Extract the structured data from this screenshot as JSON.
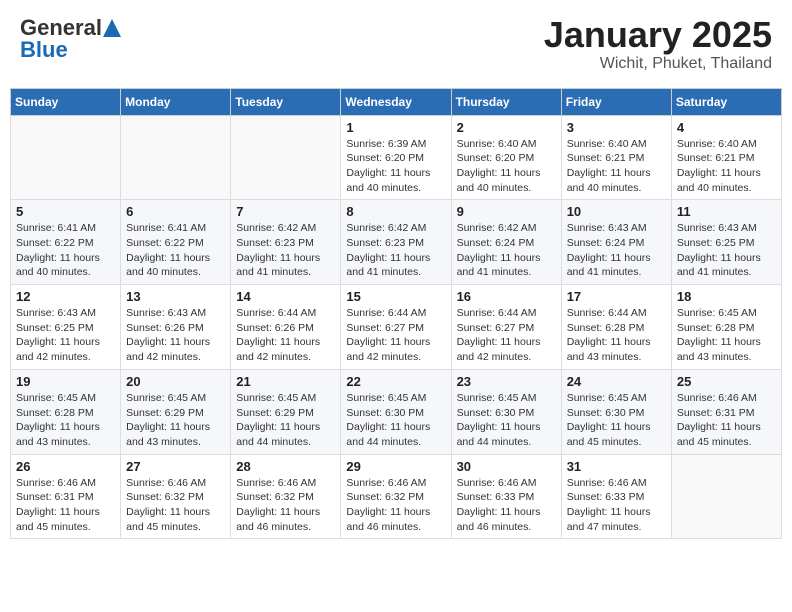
{
  "header": {
    "logo_general": "General",
    "logo_blue": "Blue",
    "month_title": "January 2025",
    "location": "Wichit, Phuket, Thailand"
  },
  "weekdays": [
    "Sunday",
    "Monday",
    "Tuesday",
    "Wednesday",
    "Thursday",
    "Friday",
    "Saturday"
  ],
  "weeks": [
    [
      {
        "day": "",
        "info": ""
      },
      {
        "day": "",
        "info": ""
      },
      {
        "day": "",
        "info": ""
      },
      {
        "day": "1",
        "info": "Sunrise: 6:39 AM\nSunset: 6:20 PM\nDaylight: 11 hours\nand 40 minutes."
      },
      {
        "day": "2",
        "info": "Sunrise: 6:40 AM\nSunset: 6:20 PM\nDaylight: 11 hours\nand 40 minutes."
      },
      {
        "day": "3",
        "info": "Sunrise: 6:40 AM\nSunset: 6:21 PM\nDaylight: 11 hours\nand 40 minutes."
      },
      {
        "day": "4",
        "info": "Sunrise: 6:40 AM\nSunset: 6:21 PM\nDaylight: 11 hours\nand 40 minutes."
      }
    ],
    [
      {
        "day": "5",
        "info": "Sunrise: 6:41 AM\nSunset: 6:22 PM\nDaylight: 11 hours\nand 40 minutes."
      },
      {
        "day": "6",
        "info": "Sunrise: 6:41 AM\nSunset: 6:22 PM\nDaylight: 11 hours\nand 40 minutes."
      },
      {
        "day": "7",
        "info": "Sunrise: 6:42 AM\nSunset: 6:23 PM\nDaylight: 11 hours\nand 41 minutes."
      },
      {
        "day": "8",
        "info": "Sunrise: 6:42 AM\nSunset: 6:23 PM\nDaylight: 11 hours\nand 41 minutes."
      },
      {
        "day": "9",
        "info": "Sunrise: 6:42 AM\nSunset: 6:24 PM\nDaylight: 11 hours\nand 41 minutes."
      },
      {
        "day": "10",
        "info": "Sunrise: 6:43 AM\nSunset: 6:24 PM\nDaylight: 11 hours\nand 41 minutes."
      },
      {
        "day": "11",
        "info": "Sunrise: 6:43 AM\nSunset: 6:25 PM\nDaylight: 11 hours\nand 41 minutes."
      }
    ],
    [
      {
        "day": "12",
        "info": "Sunrise: 6:43 AM\nSunset: 6:25 PM\nDaylight: 11 hours\nand 42 minutes."
      },
      {
        "day": "13",
        "info": "Sunrise: 6:43 AM\nSunset: 6:26 PM\nDaylight: 11 hours\nand 42 minutes."
      },
      {
        "day": "14",
        "info": "Sunrise: 6:44 AM\nSunset: 6:26 PM\nDaylight: 11 hours\nand 42 minutes."
      },
      {
        "day": "15",
        "info": "Sunrise: 6:44 AM\nSunset: 6:27 PM\nDaylight: 11 hours\nand 42 minutes."
      },
      {
        "day": "16",
        "info": "Sunrise: 6:44 AM\nSunset: 6:27 PM\nDaylight: 11 hours\nand 42 minutes."
      },
      {
        "day": "17",
        "info": "Sunrise: 6:44 AM\nSunset: 6:28 PM\nDaylight: 11 hours\nand 43 minutes."
      },
      {
        "day": "18",
        "info": "Sunrise: 6:45 AM\nSunset: 6:28 PM\nDaylight: 11 hours\nand 43 minutes."
      }
    ],
    [
      {
        "day": "19",
        "info": "Sunrise: 6:45 AM\nSunset: 6:28 PM\nDaylight: 11 hours\nand 43 minutes."
      },
      {
        "day": "20",
        "info": "Sunrise: 6:45 AM\nSunset: 6:29 PM\nDaylight: 11 hours\nand 43 minutes."
      },
      {
        "day": "21",
        "info": "Sunrise: 6:45 AM\nSunset: 6:29 PM\nDaylight: 11 hours\nand 44 minutes."
      },
      {
        "day": "22",
        "info": "Sunrise: 6:45 AM\nSunset: 6:30 PM\nDaylight: 11 hours\nand 44 minutes."
      },
      {
        "day": "23",
        "info": "Sunrise: 6:45 AM\nSunset: 6:30 PM\nDaylight: 11 hours\nand 44 minutes."
      },
      {
        "day": "24",
        "info": "Sunrise: 6:45 AM\nSunset: 6:30 PM\nDaylight: 11 hours\nand 45 minutes."
      },
      {
        "day": "25",
        "info": "Sunrise: 6:46 AM\nSunset: 6:31 PM\nDaylight: 11 hours\nand 45 minutes."
      }
    ],
    [
      {
        "day": "26",
        "info": "Sunrise: 6:46 AM\nSunset: 6:31 PM\nDaylight: 11 hours\nand 45 minutes."
      },
      {
        "day": "27",
        "info": "Sunrise: 6:46 AM\nSunset: 6:32 PM\nDaylight: 11 hours\nand 45 minutes."
      },
      {
        "day": "28",
        "info": "Sunrise: 6:46 AM\nSunset: 6:32 PM\nDaylight: 11 hours\nand 46 minutes."
      },
      {
        "day": "29",
        "info": "Sunrise: 6:46 AM\nSunset: 6:32 PM\nDaylight: 11 hours\nand 46 minutes."
      },
      {
        "day": "30",
        "info": "Sunrise: 6:46 AM\nSunset: 6:33 PM\nDaylight: 11 hours\nand 46 minutes."
      },
      {
        "day": "31",
        "info": "Sunrise: 6:46 AM\nSunset: 6:33 PM\nDaylight: 11 hours\nand 47 minutes."
      },
      {
        "day": "",
        "info": ""
      }
    ]
  ]
}
